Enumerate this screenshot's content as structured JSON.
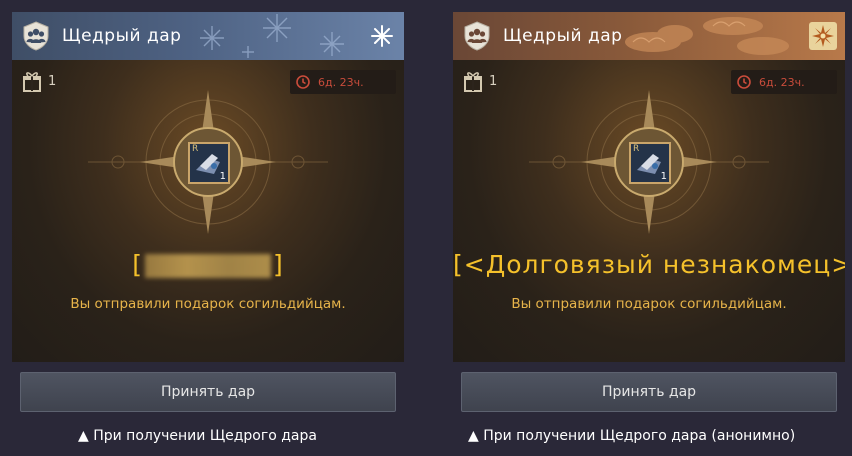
{
  "panels": [
    {
      "header": {
        "title": "Щедрый дар",
        "theme": "winter"
      },
      "gift_count": "1",
      "timer": "6д. 23ч.",
      "item": {
        "grade": "R",
        "quantity": "1"
      },
      "sender": {
        "open_bracket": "[",
        "close_bracket": "]",
        "name": ""
      },
      "message": "Вы отправили подарок согильдийцам.",
      "accept_button": "Принять дар",
      "caption": "▲ При получении Щедрого дара"
    },
    {
      "header": {
        "title": "Щедрый дар",
        "theme": "autumn"
      },
      "gift_count": "1",
      "timer": "6д. 23ч.",
      "item": {
        "grade": "R",
        "quantity": "1"
      },
      "sender": {
        "text": "[<Долговязый незнакомец>]"
      },
      "message": "Вы отправили подарок согильдийцам.",
      "accept_button": "Принять дар",
      "caption": "▲ При получении Щедрого дара (анонимно)"
    }
  ],
  "colors": {
    "accent_gold": "#f5c12b",
    "message_gold": "#e7b44a",
    "timer_red": "#c94c3b"
  },
  "icons": [
    "guild-members-icon",
    "snowflake-icon",
    "sun-flower-icon",
    "gift-icon",
    "clock-icon",
    "compass-emblem-icon",
    "item-icon"
  ]
}
